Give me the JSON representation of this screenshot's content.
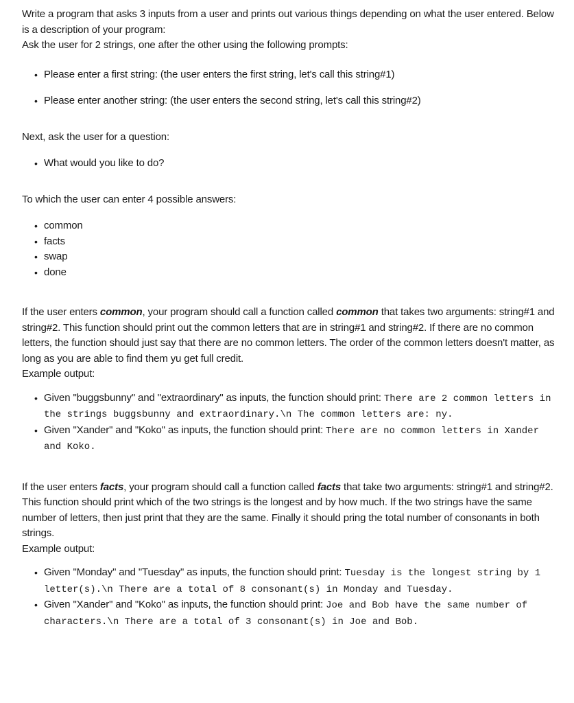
{
  "intro": {
    "line1": "Write a program that asks 3 inputs from a user and prints out various things depending on what the user entered. Below is a description of your program:",
    "line2": "Ask the user for 2 strings, one after the other using the following prompts:"
  },
  "string_prompts": [
    "Please enter a first string: (the user enters the first string, let's call this string#1)",
    "Please enter another string: (the user enters the second string, let's call this string#2)"
  ],
  "question_intro": "Next, ask the user for a question:",
  "question_prompts": [
    "What would you like to do?"
  ],
  "answers_intro": "To which the user can enter 4 possible answers:",
  "answers": [
    "common",
    "facts",
    "swap",
    "done"
  ],
  "common_section": {
    "p_start": "If the user enters ",
    "kw1": "common",
    "p_mid": ", your program should call a function called ",
    "kw2": "common",
    "p_end": " that takes two arguments: string#1 and string#2. This function should print out the common letters that are in string#1 and string#2. If there are no common letters, the function should just say that there are no common letters. The order of the common letters doesn't matter, as long as you are able to find them yu get full credit.",
    "example_label": "Example output:",
    "examples": [
      {
        "text": "Given \"buggsbunny\" and \"extraordinary\" as inputs, the function should print: ",
        "code": "There are 2 common letters in the strings buggsbunny and extraordinary.\\n The common letters are: ny."
      },
      {
        "text": "Given \"Xander\" and \"Koko\" as inputs, the function should print: ",
        "code": "There are no common letters in Xander and Koko."
      }
    ]
  },
  "facts_section": {
    "p_start": "If the user enters ",
    "kw1": "facts",
    "p_mid": ", your program should call a function called ",
    "kw2": "facts",
    "p_end": " that take two arguments: string#1 and string#2. This function should print which of the two strings is the longest and by how much. If the two strings have the same number of letters, then just print that they are the same. Finally it should pring the total number of consonants in both strings.",
    "example_label": "Example output:",
    "examples": [
      {
        "text": "Given \"Monday\" and \"Tuesday\" as inputs, the function should print: ",
        "code": "Tuesday is the longest string by 1 letter(s).\\n There are a total of 8 consonant(s) in Monday and Tuesday."
      },
      {
        "text": "Given \"Xander\" and \"Koko\" as inputs, the function should print: ",
        "code": "Joe and Bob have the same number of characters.\\n There are a total of 3 consonant(s) in Joe and Bob."
      }
    ]
  }
}
